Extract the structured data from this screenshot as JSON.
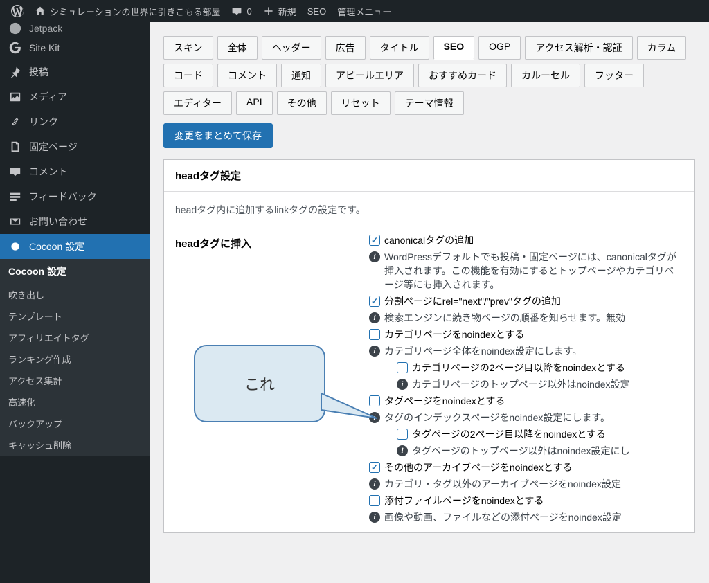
{
  "adminbar": {
    "site_title": "シミュレーションの世界に引きこもる部屋",
    "comments_count": "0",
    "new": "新規",
    "seo": "SEO",
    "admin_menu": "管理メニュー"
  },
  "sidebar": {
    "jetpack": "Jetpack",
    "sitekit": "Site Kit",
    "posts": "投稿",
    "media": "メディア",
    "links": "リンク",
    "pages": "固定ページ",
    "comments": "コメント",
    "feedback": "フィードバック",
    "contact": "お問い合わせ",
    "cocoon_settings": "Cocoon 設定",
    "submenu": {
      "title": "Cocoon 設定",
      "items": [
        "吹き出し",
        "テンプレート",
        "アフィリエイトタグ",
        "ランキング作成",
        "アクセス集計",
        "高速化",
        "バックアップ",
        "キャッシュ削除"
      ]
    }
  },
  "tabs_row1": [
    "スキン",
    "全体",
    "ヘッダー",
    "広告",
    "タイトル",
    "SEO",
    "OGP",
    "アクセス解析・認証",
    "カラム"
  ],
  "tabs_row2": [
    "コード",
    "コメント",
    "通知",
    "アピールエリア",
    "おすすめカード",
    "カルーセル",
    "フッター"
  ],
  "tabs_row3": [
    "エディター",
    "API",
    "その他",
    "リセット",
    "テーマ情報"
  ],
  "active_tab": "SEO",
  "save_button": "変更をまとめて保存",
  "panel": {
    "title": "headタグ設定",
    "description": "headタグ内に追加するlinkタグの設定です。"
  },
  "settings": {
    "label": "headタグに挿入",
    "items": [
      {
        "type": "checkbox",
        "checked": true,
        "text": "canonicalタグの追加"
      },
      {
        "type": "info",
        "text": "WordPressデフォルトでも投稿・固定ページには、canonicalタグが挿入されます。この機能を有効にするとトップページやカテゴリページ等にも挿入されます。"
      },
      {
        "type": "checkbox",
        "checked": true,
        "text": "分割ページにrel=\"next\"/\"prev\"タグの追加"
      },
      {
        "type": "info",
        "text": "検索エンジンに続き物ページの順番を知らせます。無効"
      },
      {
        "type": "checkbox",
        "checked": false,
        "text": "カテゴリページをnoindexとする"
      },
      {
        "type": "info",
        "text": "カテゴリページ全体をnoindex設定にします。"
      },
      {
        "type": "checkbox",
        "checked": false,
        "text": "カテゴリページの2ページ目以降をnoindexとする",
        "indent": true
      },
      {
        "type": "info",
        "text": "カテゴリページのトップページ以外はnoindex設定",
        "indent": true
      },
      {
        "type": "checkbox",
        "checked": false,
        "text": "タグページをnoindexとする"
      },
      {
        "type": "info",
        "text": "タグのインデックスページをnoindex設定にします。"
      },
      {
        "type": "checkbox",
        "checked": false,
        "text": "タグページの2ページ目以降をnoindexとする",
        "indent": true
      },
      {
        "type": "info",
        "text": "タグページのトップページ以外はnoindex設定にし",
        "indent": true
      },
      {
        "type": "checkbox",
        "checked": true,
        "text": "その他のアーカイブページをnoindexとする"
      },
      {
        "type": "info",
        "text": "カテゴリ・タグ以外のアーカイブページをnoindex設定"
      },
      {
        "type": "checkbox",
        "checked": false,
        "text": "添付ファイルページをnoindexとする"
      },
      {
        "type": "info",
        "text": "画像や動画、ファイルなどの添付ページをnoindex設定"
      }
    ]
  },
  "callout": "これ"
}
